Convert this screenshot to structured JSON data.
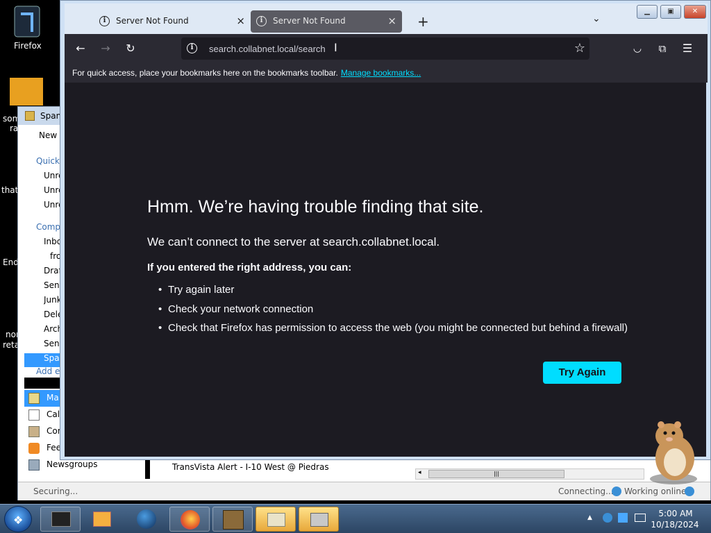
{
  "desktop": {
    "firefox_label": "Firefox",
    "frag_some": "som",
    "frag_ra": "ra",
    "frag_that": "that",
    "frag_end": "End",
    "frag_nor": "nor",
    "frag_reta": "reta"
  },
  "mail": {
    "title": "Spam",
    "new_label": "New",
    "quick_label": "Quick",
    "unread_1": "Unre",
    "unread_2": "Unre",
    "unread_3": "Unre",
    "comp_label": "Comp",
    "inbox": "Inbo",
    "from": "fro",
    "drafts": "Draf",
    "sent": "Sent",
    "junk": "Junk",
    "deleted": "Dele",
    "archive": "Arch",
    "sent2": "Sent",
    "spam": "Spar",
    "add": "Add e",
    "nav_mail": "Ma",
    "nav_calendar": "Cal",
    "nav_contacts": "Cor",
    "nav_feeds": "Fee",
    "nav_newsgroups": "Newsgroups",
    "message_subject": "TransVista Alert - I-10 West @ Piedras",
    "status_left": "Securing...",
    "status_connecting": "Connecting...",
    "status_online": "Working online"
  },
  "firefox": {
    "tabs": [
      {
        "title": "Server Not Found",
        "close": "×"
      },
      {
        "title": "Server Not Found",
        "close": "×"
      }
    ],
    "new_tab": "+",
    "tab_list": "⌄",
    "url": "search.collabnet.local/search",
    "bookmarks_msg": "For quick access, place your bookmarks here on the bookmarks toolbar.",
    "bookmarks_link": "Manage bookmarks...",
    "error": {
      "title": "Hmm. We’re having trouble finding that site.",
      "description": "We can’t connect to the server at search.collabnet.local.",
      "subtitle": "If you entered the right address, you can:",
      "items": [
        "Try again later",
        "Check your network connection",
        "Check that Firefox has permission to access the web (you might be connected but behind a firewall)"
      ],
      "button": "Try Again"
    }
  },
  "taskbar": {
    "time": "5:00 AM",
    "date": "10/18/2024"
  },
  "colors": {
    "accent": "#00ddff",
    "page_bg": "#1c1b22",
    "toolbar_bg": "#2b2a33"
  }
}
